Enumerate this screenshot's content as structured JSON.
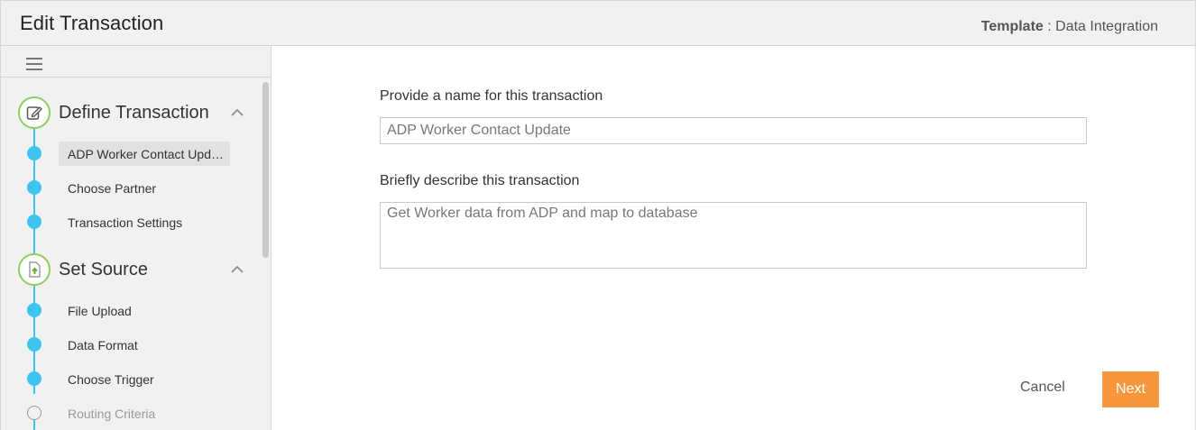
{
  "header": {
    "title": "Edit Transaction",
    "template_label": "Template",
    "template_separator": " : ",
    "template_value": "Data Integration"
  },
  "sidebar": {
    "menu_icon": "hamburger-icon",
    "sections": [
      {
        "title": "Define Transaction",
        "icon": "edit-icon",
        "steps": [
          {
            "label": "ADP Worker Contact Upd…",
            "state": "active"
          },
          {
            "label": "Choose Partner",
            "state": "complete"
          },
          {
            "label": "Transaction Settings",
            "state": "complete"
          }
        ]
      },
      {
        "title": "Set Source",
        "icon": "file-upload-icon",
        "steps": [
          {
            "label": "File Upload",
            "state": "complete"
          },
          {
            "label": "Data Format",
            "state": "complete"
          },
          {
            "label": "Choose Trigger",
            "state": "complete"
          },
          {
            "label": "Routing Criteria",
            "state": "incomplete"
          }
        ]
      }
    ]
  },
  "form": {
    "name_label": "Provide a name for this transaction",
    "name_value": "ADP Worker Contact Update",
    "desc_label": "Briefly describe this transaction",
    "desc_value": "Get Worker data from ADP and map to database"
  },
  "actions": {
    "cancel_label": "Cancel",
    "next_label": "Next"
  },
  "colors": {
    "accent_orange": "#f7963a",
    "timeline_blue": "#3ec4f0",
    "section_ring_green": "#8fce5a"
  }
}
